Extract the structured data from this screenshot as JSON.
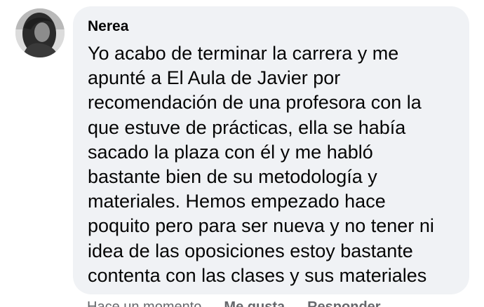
{
  "comment": {
    "author": "Nerea",
    "text_lines": [
      "Yo acabo de terminar la carrera y me",
      "apunté a El Aula de Javier por",
      "recomendación de una profesora con la",
      "que estuve de prácticas, ella se había",
      "sacado la plaza con él y me habló",
      "bastante bien de su metodología y",
      "materiales. Hemos empezado hace",
      "poquito pero para ser nueva y no tener ni",
      "idea de las oposiciones estoy bastante",
      "contenta con las clases y sus materiales"
    ],
    "avatar_icon": "user-avatar-photo"
  },
  "actions": {
    "timestamp": "Hace un momento",
    "like_label": "Me gusta",
    "reply_label": "Responder"
  },
  "colors": {
    "bubble_background": "#f0f2f5",
    "text": "#050505",
    "secondary_text": "#65676b"
  }
}
